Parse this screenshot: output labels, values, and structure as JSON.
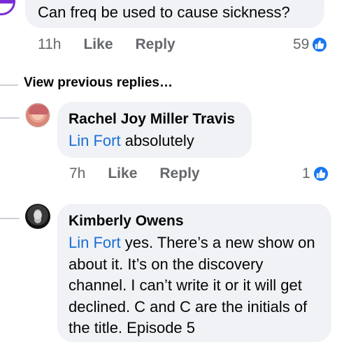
{
  "top_comment": {
    "text": "Can freq be used to cause sickness?",
    "time": "11h",
    "like_label": "Like",
    "reply_label": "Reply",
    "like_count": "59"
  },
  "view_previous": "View previous replies…",
  "replies": [
    {
      "author": "Rachel Joy Miller Travis",
      "mention": "Lin Fort",
      "text": " absolutely",
      "time": "7h",
      "like_label": "Like",
      "reply_label": "Reply",
      "like_count": "1"
    },
    {
      "author": "Kimberly Owens",
      "mention": "Lin Fort",
      "text": " yes. There’s a new show on about it. It’s on the discovery channel. I can’t write it or it will get declined. C and C are the initials of the title. Episode 5"
    }
  ],
  "colors": {
    "bubble": "#f0f2f5",
    "mention": "#1a6ed8",
    "like_blue": "#1877f2",
    "meta_gray": "#65676b"
  },
  "icons": {
    "like_badge": "thumbs-up-icon"
  }
}
